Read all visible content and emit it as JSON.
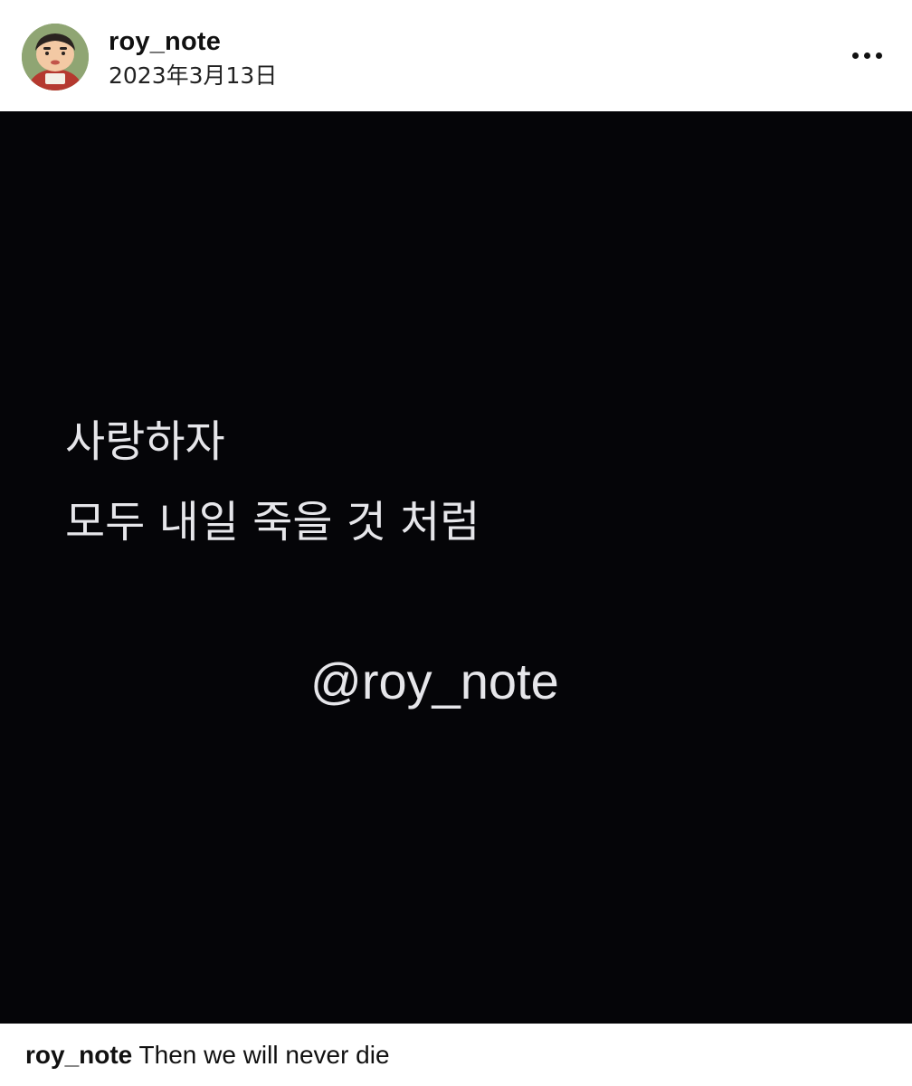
{
  "post": {
    "author": "roy_note",
    "date": "2023年3月13日",
    "more_icon": "more-horizontal-icon"
  },
  "image": {
    "line1": "사랑하자",
    "line2": "모두 내일 죽을 것 처럼",
    "watermark": "@roy_note",
    "background_color": "#050508",
    "text_color": "#e6e6ea"
  },
  "caption": {
    "username": "roy_note",
    "text": "Then we will never die"
  }
}
